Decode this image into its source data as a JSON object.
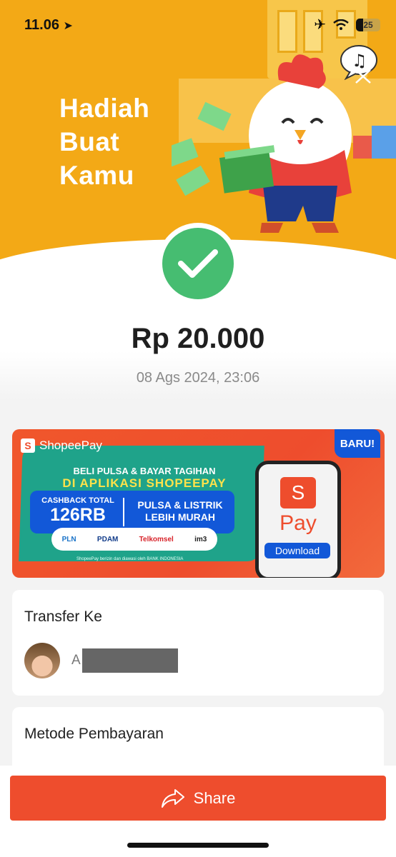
{
  "status_bar": {
    "time": "11.06",
    "battery": "25"
  },
  "hero": {
    "title_lines": [
      "Hadiah",
      "Buat",
      "Kamu"
    ]
  },
  "transaction": {
    "amount": "Rp 20.000",
    "datetime": "08 Ags 2024, 23:06",
    "status_color": "#46bd71"
  },
  "banner": {
    "brand": "ShopeePay",
    "headline_line1": "BELI PULSA & BAYAR TAGIHAN",
    "headline_line2": "DI APLIKASI SHOPEEPAY",
    "cashback_label": "CASHBACK TOTAL",
    "cashback_value": "126RB",
    "promo_line1": "PULSA & LISTRIK",
    "promo_line2": "LEBIH MURAH",
    "partners": [
      "PLN",
      "PDAM",
      "Telkomsel",
      "im3"
    ],
    "disclaimer": "ShopeePay berizin dan diawasi oleh BANK INDONESIA",
    "app_logo": "S",
    "app_name": "Pay",
    "download_label": "Download",
    "badge": "BARU!"
  },
  "transfer": {
    "title": "Transfer Ke",
    "recipient_initial": "A"
  },
  "payment_method": {
    "title": "Metode Pembayaran"
  },
  "actions": {
    "share_label": "Share"
  },
  "colors": {
    "hero": "#f3a916",
    "accent": "#ee4d2d",
    "success": "#46bd71",
    "blue": "#1258d8"
  }
}
